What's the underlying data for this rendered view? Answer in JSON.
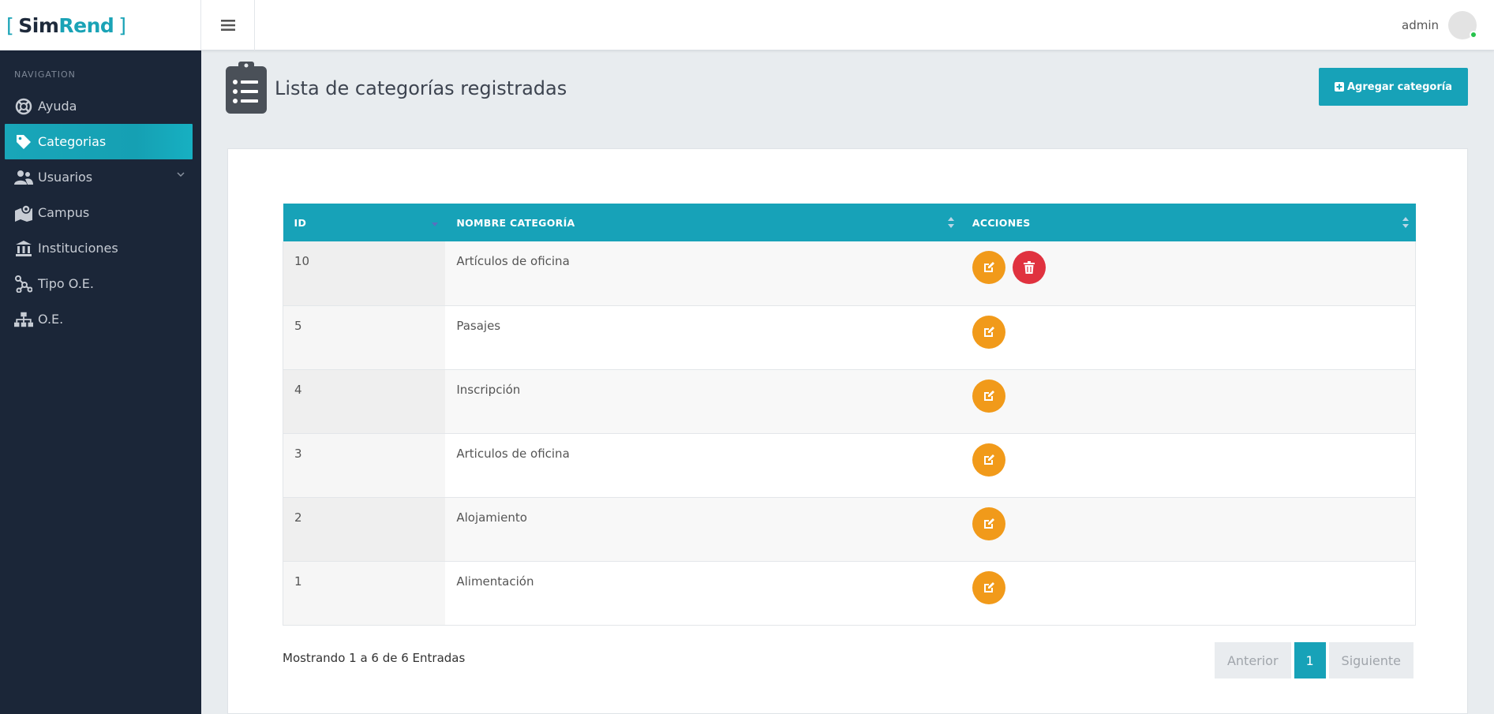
{
  "brand": {
    "open_bracket": "[",
    "sim": "Sim",
    "rend": "Rend",
    "close_bracket": "]"
  },
  "header": {
    "menu_icon": "hamburger-icon",
    "username": "admin",
    "status_color": "#27c24c"
  },
  "sidebar": {
    "heading": "NAVIGATION",
    "items": [
      {
        "label": "Ayuda",
        "icon": "lifebuoy-icon",
        "active": false
      },
      {
        "label": "Categorias",
        "icon": "tag-icon",
        "active": true
      },
      {
        "label": "Usuarios",
        "icon": "users-icon",
        "active": false,
        "has_submenu": true
      },
      {
        "label": "Campus",
        "icon": "map-icon",
        "active": false
      },
      {
        "label": "Instituciones",
        "icon": "bank-icon",
        "active": false
      },
      {
        "label": "Tipo O.E.",
        "icon": "hub-icon",
        "active": false
      },
      {
        "label": "O.E.",
        "icon": "sitemap-icon",
        "active": false
      }
    ]
  },
  "page": {
    "title": "Lista de categorías registradas",
    "icon": "clipboard-list-icon",
    "add_button": "Agregar categoría"
  },
  "table": {
    "columns": [
      "ID",
      "NOMBRE CATEGORÍA",
      "ACCIONES"
    ],
    "rows": [
      {
        "id": "10",
        "name": "Artículos de oficina",
        "deletable": true
      },
      {
        "id": "5",
        "name": "Pasajes",
        "deletable": false
      },
      {
        "id": "4",
        "name": "Inscripción",
        "deletable": false
      },
      {
        "id": "3",
        "name": "Articulos de oficina",
        "deletable": false
      },
      {
        "id": "2",
        "name": "Alojamiento",
        "deletable": false
      },
      {
        "id": "1",
        "name": "Alimentación",
        "deletable": false
      }
    ],
    "info": "Mostrando 1 a 6 de 6 Entradas"
  },
  "pagination": {
    "previous": "Anterior",
    "current": "1",
    "next": "Siguiente"
  },
  "colors": {
    "accent": "#17a2b8",
    "sidebar_bg": "#1b2638",
    "edit": "#f19a1a",
    "delete": "#e0323f"
  }
}
